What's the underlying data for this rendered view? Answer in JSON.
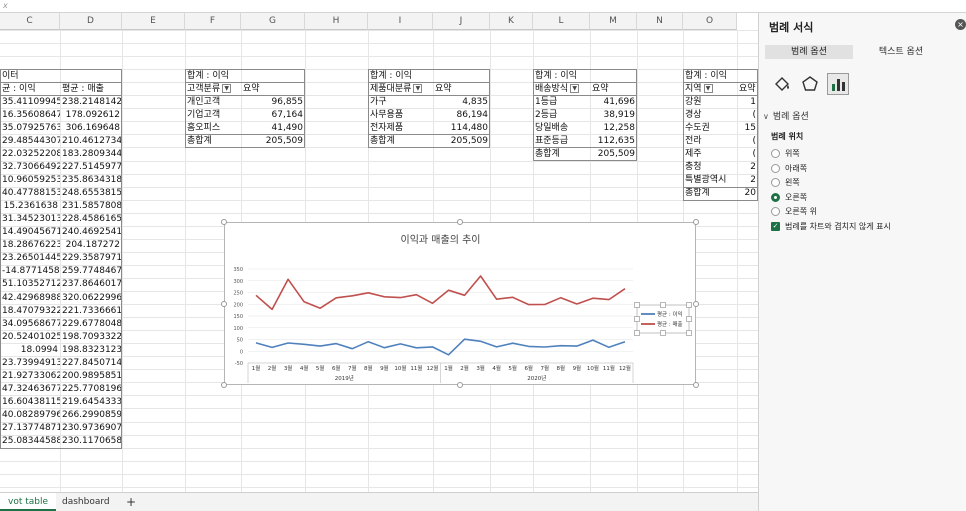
{
  "formula_bar": {
    "text": "x"
  },
  "columns": [
    "C",
    "D",
    "E",
    "F",
    "G",
    "H",
    "I",
    "J",
    "K",
    "L",
    "M",
    "N",
    "O"
  ],
  "table_main": {
    "title": "이터",
    "headers": [
      "균 : 이익",
      "평균 : 매출"
    ],
    "rows": [
      [
        "35.41109945",
        "238.2148142"
      ],
      [
        "16.35608647",
        "178.092612"
      ],
      [
        "35.07925763",
        "306.169648"
      ],
      [
        "29.48544307",
        "210.4612734"
      ],
      [
        "22.03252208",
        "183.2809344"
      ],
      [
        "32.73066492",
        "227.5145977"
      ],
      [
        "10.96059253",
        "235.8634318"
      ],
      [
        "40.47788153",
        "248.6553815"
      ],
      [
        "15.2361638",
        "231.5857808"
      ],
      [
        "31.34523013",
        "228.4586165"
      ],
      [
        "14.49045671",
        "240.4692541"
      ],
      [
        "18.28676223",
        "204.187272"
      ],
      [
        "23.26501445",
        "229.3587971"
      ],
      [
        "-14.87714583",
        "259.7748467"
      ],
      [
        "51.10352712",
        "237.8646017"
      ],
      [
        "42.42968988",
        "320.0622996"
      ],
      [
        "18.47079322",
        "221.7336661"
      ],
      [
        "34.09568677",
        "229.6778048"
      ],
      [
        "20.52401025",
        "198.7093322"
      ],
      [
        "18.0994",
        "198.8323123"
      ],
      [
        "23.73994913",
        "227.8450714"
      ],
      [
        "21.92733062",
        "200.9895851"
      ],
      [
        "47.32463677",
        "225.7708196"
      ],
      [
        "16.60438115",
        "219.6454333"
      ],
      [
        "40.08289796",
        "266.2990859"
      ],
      [
        "27.13774871",
        "230.9736907"
      ],
      [
        "25.08344588",
        "230.1170658"
      ]
    ]
  },
  "pivot_customer": {
    "title": "합계 : 이익",
    "header": [
      "고객분류",
      "요약"
    ],
    "rows": [
      [
        "개인고객",
        "96,855"
      ],
      [
        "기업고객",
        "67,164"
      ],
      [
        "홈오피스",
        "41,490"
      ],
      [
        "총합계",
        "205,509"
      ]
    ]
  },
  "pivot_product": {
    "title": "합계 : 이익",
    "header": [
      "제품대분류",
      "요약"
    ],
    "rows": [
      [
        "가구",
        "4,835"
      ],
      [
        "사무용품",
        "86,194"
      ],
      [
        "전자제품",
        "114,480"
      ],
      [
        "총합계",
        "205,509"
      ]
    ]
  },
  "pivot_shipping": {
    "title": "합계 : 이익",
    "header": [
      "배송방식",
      "요약"
    ],
    "rows": [
      [
        "1등급",
        "41,696"
      ],
      [
        "2등급",
        "38,919"
      ],
      [
        "당일배송",
        "12,258"
      ],
      [
        "표준등급",
        "112,635"
      ],
      [
        "총합계",
        "205,509"
      ]
    ]
  },
  "pivot_region": {
    "title": "합계 : 이익",
    "header": [
      "지역",
      "요약"
    ],
    "rows": [
      [
        "강원",
        "1"
      ],
      [
        "경상",
        "("
      ],
      [
        "수도권",
        "15"
      ],
      [
        "전라",
        "("
      ],
      [
        "제주",
        "("
      ],
      [
        "충청",
        "2"
      ],
      [
        "특별광역시",
        "2"
      ],
      [
        "총합계",
        "20"
      ]
    ]
  },
  "chart_data": {
    "type": "line",
    "title": "이익과 매출의 추이",
    "categories": [
      "1월",
      "2월",
      "3월",
      "4월",
      "5월",
      "6월",
      "7월",
      "8월",
      "9월",
      "10월",
      "11월",
      "12월",
      "1월",
      "2월",
      "3월",
      "4월",
      "5월",
      "6월",
      "7월",
      "8월",
      "9월",
      "10월",
      "11월",
      "12월"
    ],
    "groups": [
      {
        "label": "2019년",
        "start": 0,
        "end": 11
      },
      {
        "label": "2020년",
        "start": 12,
        "end": 23
      }
    ],
    "ylim": [
      -50,
      350
    ],
    "yticks": [
      -50,
      0,
      50,
      100,
      150,
      200,
      250,
      300,
      350
    ],
    "legend_position": "right",
    "series": [
      {
        "name": "평균 : 이익",
        "color": "#4f81bd",
        "values": [
          35.4,
          16.4,
          35.1,
          29.5,
          22.0,
          32.7,
          11.0,
          40.5,
          15.2,
          31.3,
          14.5,
          18.3,
          -14.9,
          51.1,
          42.4,
          18.5,
          34.1,
          20.5,
          18.1,
          23.7,
          21.9,
          47.3,
          16.6,
          40.1
        ]
      },
      {
        "name": "평균 : 매출",
        "color": "#c0504d",
        "values": [
          238.2,
          178.1,
          306.2,
          210.5,
          183.3,
          227.5,
          235.9,
          248.7,
          231.6,
          228.5,
          240.5,
          204.2,
          259.8,
          237.9,
          320.1,
          221.7,
          229.7,
          198.7,
          198.8,
          227.8,
          201.0,
          225.8,
          219.6,
          266.3
        ]
      }
    ]
  },
  "tabs": {
    "active": "vot table",
    "other": "dashboard",
    "add": "+"
  },
  "panel": {
    "title": "범례 서식",
    "close": "×",
    "tab_legend": "범례 옵션",
    "tab_text": "텍스트 옵션",
    "icons": {
      "fill": "paint-bucket-icon",
      "effects": "pentagon-icon",
      "options": "bar-chart-icon"
    },
    "section": "범례 옵션",
    "position_title": "범례 위치",
    "positions": [
      "위쪽",
      "아래쪽",
      "왼쪽",
      "오른쪽",
      "오른쪽 위"
    ],
    "selected_position": "오른쪽",
    "overlap_label": "범례를 차트와 겹치지 않게 표시"
  }
}
